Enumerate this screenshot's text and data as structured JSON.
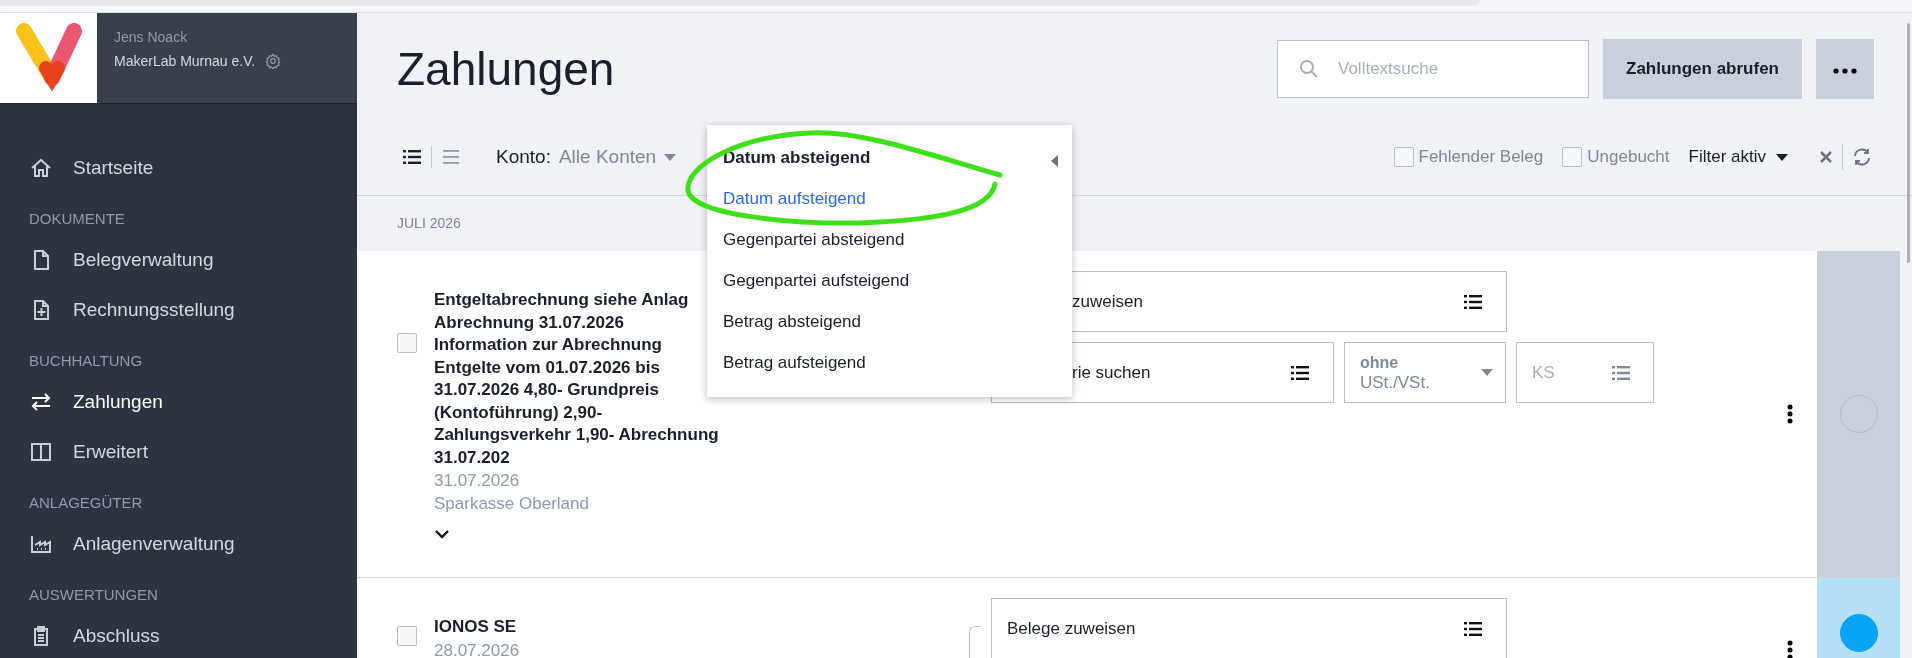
{
  "sidebar": {
    "user": "Jens Noack",
    "org": "MakerLab Murnau e.V.",
    "items": [
      {
        "kind": "link",
        "label": "Startseite",
        "selected": false
      },
      {
        "kind": "section",
        "label": "DOKUMENTE"
      },
      {
        "kind": "link",
        "label": "Belegverwaltung",
        "selected": false
      },
      {
        "kind": "link",
        "label": "Rechnungsstellung",
        "selected": false
      },
      {
        "kind": "section",
        "label": "BUCHHALTUNG"
      },
      {
        "kind": "link",
        "label": "Zahlungen",
        "selected": true
      },
      {
        "kind": "link",
        "label": "Erweitert",
        "selected": false
      },
      {
        "kind": "section",
        "label": "ANLAGEGÜTER"
      },
      {
        "kind": "link",
        "label": "Anlagenverwaltung",
        "selected": false
      },
      {
        "kind": "section",
        "label": "AUSWERTUNGEN"
      },
      {
        "kind": "link",
        "label": "Abschluss",
        "selected": false
      }
    ]
  },
  "header": {
    "title": "Zahlungen",
    "search": {
      "placeholder": "Volltextsuche"
    },
    "fetch_button": "Zahlungen abrufen"
  },
  "toolbar": {
    "view_modes": [
      {
        "selected": true
      },
      {
        "selected": false
      }
    ],
    "account": {
      "label": "Konto:",
      "value": "Alle Konten"
    },
    "checkboxes": [
      {
        "label": "Fehlender Beleg",
        "checked": false
      },
      {
        "label": "Ungebucht",
        "checked": false
      }
    ],
    "filter": "Filter aktiv"
  },
  "sort_menu": {
    "items": [
      {
        "label": "Datum absteigend",
        "selected": true,
        "highlighted": false
      },
      {
        "label": "Datum aufsteigend",
        "selected": false,
        "highlighted": true
      },
      {
        "label": "Gegenpartei absteigend",
        "selected": false,
        "highlighted": false
      },
      {
        "label": "Gegenpartei aufsteigend",
        "selected": false,
        "highlighted": false
      },
      {
        "label": "Betrag absteigend",
        "selected": false,
        "highlighted": false
      },
      {
        "label": "Betrag aufsteigend",
        "selected": false,
        "highlighted": false
      }
    ]
  },
  "group_label": "JULI 2026",
  "payments": [
    {
      "title_lines": [
        "Entgeltabrechnung siehe Anlag",
        "Abrechnung 31.07.2026",
        "Information zur Abrechnung",
        "Entgelte vom 01.07.2026 bis",
        "31.07.2026 4,80- Grundpreis",
        "(Kontoführung) 2,90-",
        "Zahlungsverkehr 1,90- Abrechnung",
        "31.07.202"
      ],
      "date": "31.07.2026",
      "bank": "Sparkasse Oberland",
      "checked": false,
      "color": "#c9d0db",
      "done": false,
      "assign": "zuweisen",
      "category": "rie suchen",
      "tax": {
        "top": "ohne",
        "bottom": "USt./VSt."
      },
      "cost_center": {
        "placeholder": "KS"
      }
    },
    {
      "title_lines": [
        "IONOS SE"
      ],
      "date": "28.07.2026",
      "checked": false,
      "color": "#b3e0f6",
      "done": true,
      "assign": "Belege zuweisen"
    }
  ]
}
